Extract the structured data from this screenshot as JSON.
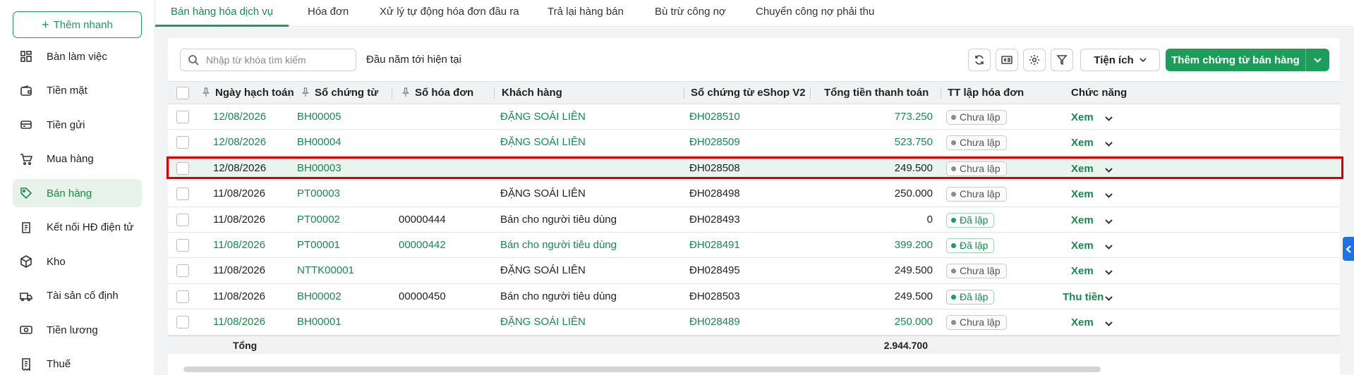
{
  "sidebar": {
    "quick_add": "Thêm nhanh",
    "items": [
      {
        "label": "Bàn làm việc",
        "icon": "dashboard-icon"
      },
      {
        "label": "Tiền mặt",
        "icon": "wallet-icon"
      },
      {
        "label": "Tiền gửi",
        "icon": "card-icon"
      },
      {
        "label": "Mua hàng",
        "icon": "cart-icon"
      },
      {
        "label": "Bán hàng",
        "icon": "tag-icon"
      },
      {
        "label": "Kết nối HĐ điện tử",
        "icon": "invoice-link-icon"
      },
      {
        "label": "Kho",
        "icon": "box-icon"
      },
      {
        "label": "Tài sản cố định",
        "icon": "truck-icon"
      },
      {
        "label": "Tiền lương",
        "icon": "money-icon"
      },
      {
        "label": "Thuế",
        "icon": "tax-icon"
      }
    ]
  },
  "tabs": [
    "Bán hàng hóa dịch vụ",
    "Hóa đơn",
    "Xử lý tự động hóa đơn đầu ra",
    "Trả lại hàng bán",
    "Bù trừ công nợ",
    "Chuyển công nợ phải thu"
  ],
  "toolbar": {
    "search_placeholder": "Nhập từ khóa tìm kiếm",
    "period": "Đầu năm tới hiện tại",
    "utility": "Tiện ích",
    "add": "Thêm chứng từ bán hàng"
  },
  "columns": {
    "date": "Ngày hạch toán",
    "voucher": "Số chứng từ",
    "invoice": "Số hóa đơn",
    "customer": "Khách hàng",
    "eshop": "Số chứng từ eShop V2",
    "total": "Tổng tiền thanh toán",
    "status": "TT lập hóa đơn",
    "action": "Chức năng"
  },
  "rows": [
    {
      "date": "12/08/2026",
      "voucher": "BH00005",
      "invoice": "",
      "customer": "ĐẶNG SOÁI LIÊN",
      "eshop": "ĐH028510",
      "total": "773.250",
      "status": "Chưa lập",
      "action": "Xem"
    },
    {
      "date": "12/08/2026",
      "voucher": "BH00004",
      "invoice": "",
      "customer": "ĐẶNG SOÁI LIÊN",
      "eshop": "ĐH028509",
      "total": "523.750",
      "status": "Chưa lập",
      "action": "Xem"
    },
    {
      "date": "12/08/2026",
      "voucher": "BH00003",
      "invoice": "",
      "customer": "",
      "eshop": "ĐH028508",
      "total": "249.500",
      "status": "Chưa lập",
      "action": "Xem"
    },
    {
      "date": "11/08/2026",
      "voucher": "PT00003",
      "invoice": "",
      "customer": "ĐẶNG SOÁI LIÊN",
      "eshop": "ĐH028498",
      "total": "250.000",
      "status": "Chưa lập",
      "action": "Xem"
    },
    {
      "date": "11/08/2026",
      "voucher": "PT00002",
      "invoice": "00000444",
      "customer": "Bán cho người tiêu dùng",
      "eshop": "ĐH028493",
      "total": "0",
      "status": "Đã lập",
      "action": "Xem"
    },
    {
      "date": "11/08/2026",
      "voucher": "PT00001",
      "invoice": "00000442",
      "customer": "Bán cho người tiêu dùng",
      "eshop": "ĐH028491",
      "total": "399.200",
      "status": "Đã lập",
      "action": "Xem"
    },
    {
      "date": "11/08/2026",
      "voucher": "NTTK00001",
      "invoice": "",
      "customer": "ĐẶNG SOÁI LIÊN",
      "eshop": "ĐH028495",
      "total": "249.500",
      "status": "Chưa lập",
      "action": "Xem"
    },
    {
      "date": "11/08/2026",
      "voucher": "BH00002",
      "invoice": "00000450",
      "customer": "Bán cho người tiêu dùng",
      "eshop": "ĐH028503",
      "total": "249.500",
      "status": "Đã lập",
      "action": "Thu tiền"
    },
    {
      "date": "11/08/2026",
      "voucher": "BH00001",
      "invoice": "",
      "customer": "ĐẶNG SOÁI LIÊN",
      "eshop": "ĐH028489",
      "total": "250.000",
      "status": "Chưa lập",
      "action": "Xem"
    }
  ],
  "footer": {
    "label": "Tổng",
    "total": "2.944.700"
  },
  "colors": {
    "accent": "#1e9c5a",
    "selection_outline": "#d60000"
  }
}
